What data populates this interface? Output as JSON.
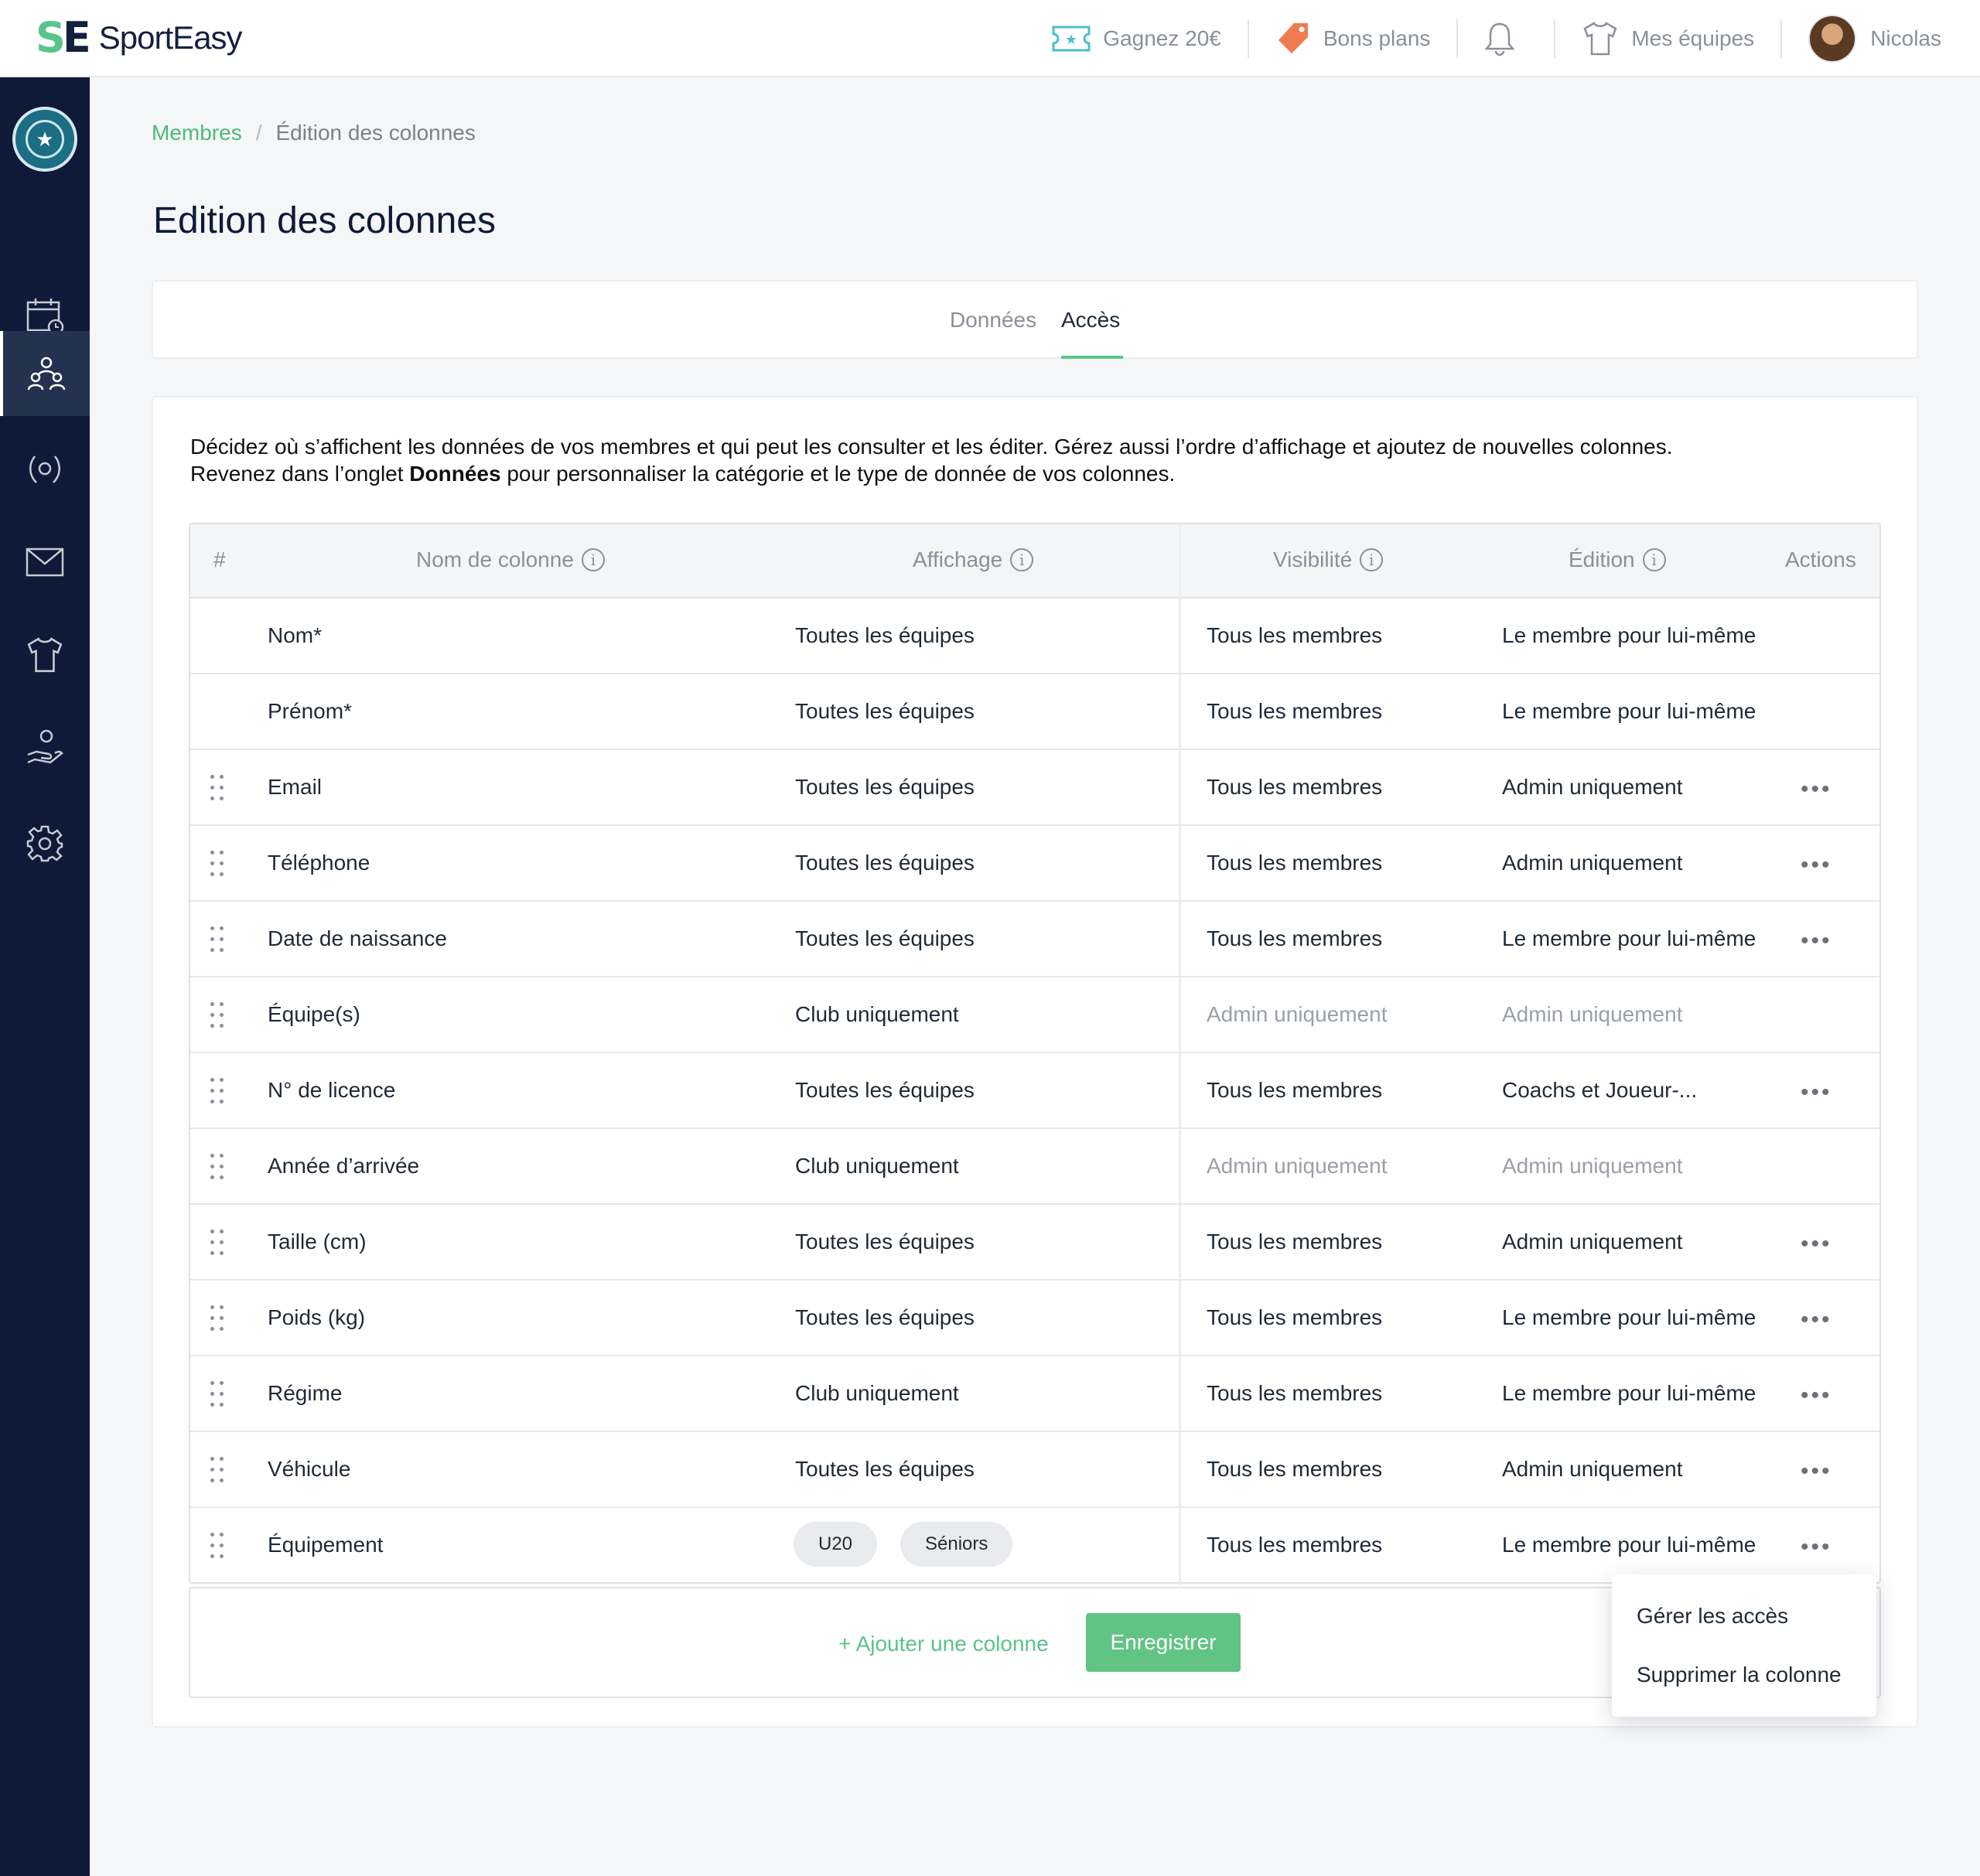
{
  "brand": {
    "logo_text": "SportEasy"
  },
  "topbar": {
    "gift_label": "Gagnez 20€",
    "deals_label": "Bons plans",
    "teams_label": "Mes équipes",
    "user_name": "Nicolas"
  },
  "breadcrumb": {
    "parent": "Membres",
    "separator": "/",
    "current": "Édition des colonnes"
  },
  "page_title": "Edition des colonnes",
  "tabs": [
    {
      "label": "Données",
      "active": false
    },
    {
      "label": "Accès",
      "active": true
    }
  ],
  "description": {
    "line1": "Décidez où s’affichent les données de vos membres et qui peut les consulter et les éditer. Gérez aussi l’ordre d’affichage et ajoutez de nouvelles colonnes.",
    "line2_prefix": "Revenez dans l’onglet ",
    "line2_bold": "Données",
    "line2_suffix": " pour personnaliser la catégorie et le type de donnée de vos colonnes."
  },
  "table": {
    "headers": {
      "index": "#",
      "name": "Nom de colonne",
      "display": "Affichage",
      "visibility": "Visibilité",
      "edit": "Édition",
      "actions": "Actions"
    },
    "rows": [
      {
        "name": "Nom*",
        "display": "Toutes les équipes",
        "visibility": "Tous les membres",
        "edit": "Le membre pour lui-même"
      },
      {
        "name": "Prénom*",
        "display": "Toutes les équipes",
        "visibility": "Tous les membres",
        "edit": "Le membre pour lui-même"
      },
      {
        "name": "Email",
        "display": "Toutes les équipes",
        "visibility": "Tous les membres",
        "edit": "Admin uniquement"
      },
      {
        "name": "Téléphone",
        "display": "Toutes les équipes",
        "visibility": "Tous les membres",
        "edit": "Admin uniquement"
      },
      {
        "name": "Date de naissance",
        "display": "Toutes les équipes",
        "visibility": "Tous les membres",
        "edit": "Le membre pour lui-même"
      },
      {
        "name": "Équipe(s)",
        "display": "Club uniquement",
        "visibility": "Admin uniquement",
        "edit": "Admin uniquement"
      },
      {
        "name": "N° de licence",
        "display": "Toutes les équipes",
        "visibility": "Tous les membres",
        "edit": "Coachs et Joueur-..."
      },
      {
        "name": "Année d’arrivée",
        "display": "Club uniquement",
        "visibility": "Admin uniquement",
        "edit": "Admin uniquement"
      },
      {
        "name": "Taille (cm)",
        "display": "Toutes les équipes",
        "visibility": "Tous les membres",
        "edit": "Admin uniquement"
      },
      {
        "name": "Poids (kg)",
        "display": "Toutes les équipes",
        "visibility": "Tous les membres",
        "edit": "Le membre pour lui-même"
      },
      {
        "name": "Régime",
        "display": "Club uniquement",
        "visibility": "Tous les membres",
        "edit": "Le membre pour lui-même"
      },
      {
        "name": "Véhicule",
        "display": "Toutes les équipes",
        "visibility": "Tous les membres",
        "edit": "Admin uniquement"
      },
      {
        "name": "Équipement",
        "display_chips": [
          "U20",
          "Séniors"
        ],
        "visibility": "Tous les membres",
        "edit": "Le membre pour lui-même"
      }
    ]
  },
  "footer": {
    "add_column": "+ Ajouter une colonne",
    "save": "Enregistrer"
  },
  "context_menu": {
    "manage_access": "Gérer les accès",
    "delete_column": "Supprimer la colonne"
  },
  "colors": {
    "accent": "#5ac48a",
    "sidebar": "#0e1a37",
    "muted_text": "#9aa0a8"
  }
}
